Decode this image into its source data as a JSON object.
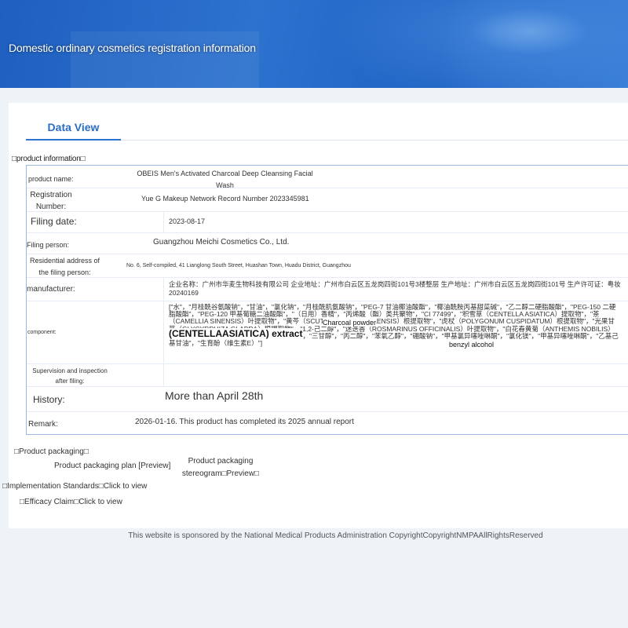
{
  "banner": {
    "title": "Domestic ordinary cosmetics registration information"
  },
  "tabs": {
    "active_label": "Data View"
  },
  "sections": {
    "product_info": "□product information□",
    "product_packaging": "□Product packaging□",
    "implementation_standards": "□Implementation Standards□Click to view",
    "efficacy_claim": "□Efficacy Claim□Click to view"
  },
  "product": {
    "name_label": "product name:",
    "name_value": "OBEIS Men's Activated Charcoal Deep Cleansing Facial Wash",
    "registration_label": "Registration Number:",
    "registration_value": "Yue G Makeup Network Record Number 2023345981",
    "filing_date_label": "Filing date:",
    "filing_date_value": "2023-08-17",
    "filing_person_label": "Filing person:",
    "filing_person_value": "Guangzhou Meichi Cosmetics Co., Ltd.",
    "address_label": "Residential address of the filing person:",
    "address_value": "No. 6, Self-compiled, 41 Lianglong South Street, Huashan Town, Huadu District, Guangzhou",
    "manufacturer_label": "manufacturer:",
    "manufacturer_value": "企业名称：广州市华麦生物科技有限公司 企业地址：广州市白云区五龙岗四街101号3楼整层 生产地址：广州市白云区五龙岗四街101号 生产许可证：粤妆20240169",
    "component_label": "component:",
    "component_value": "[\"水\"，\"月桂酰谷氨酸钠\"，\"甘油\"，\"氯化钠\"，\"月桂酰肌氨酸钠\"，\"PEG-7 甘油椰油酸酯\"，\"椰油酰胺丙基甜菜碱\"，\"乙二醇二硬脂酸酯\"，\"PEG-150 二硬脂酸酯\"，\"PEG-120 甲基葡糖二油酸酯\"，\"（日用）香精\"，\"丙烯酸（酯）类共聚物\"，\"CI 77499\"，\"积雪草（CENTELLA ASIATICA）提取物\"，\"茶（CAMELLIA SINENSIS）叶提取物\"，\"黄芩（SCUTELLARIA BAICALENSIS）根提取物\"，\"虎杖（POLYGONUM CUSPIDATUM）根提取物\"，\"光果甘草（GLYCYRRHIZA GLABRA）根提取物\"，\"1,2-己二醇\"，\"迷迭香（ROSMARINUS OFFICINALIS）叶提取物\"，\"白花春黄菊（ANTHEMIS NOBILIS）花提取物\"，\"聚季铵盐-7\"，\"DMDM 乙内酰脲\"，\"三甘醇\"，\"丙二醇\"，\"苯氧乙醇\"，\"硼酸钠\"，\"甲基氯异噻唑啉酮\"，\"氯化镁\"，\"甲基异噻唑啉酮\"，\"乙基己基甘油\"，\"生育酚（维生素E）\"]",
    "component_overlay_1": "Charcoal powder",
    "component_overlay_2": "(CENTELLAASIATICA) extract",
    "component_overlay_3": "benzyl alcohol",
    "supervision_label": "Supervision and inspection after filing:",
    "supervision_value": "",
    "history_label": "History:",
    "history_value": "More than April 28th",
    "remark_label": "Remark:",
    "remark_value": "2026-01-16. This product has completed its 2025 annual report"
  },
  "packaging": {
    "plan_label": "Product packaging plan [Preview]",
    "stereogram_label": "Product packaging stereogram□Preview□"
  },
  "footer": {
    "text": "This website is sponsored by the National Medical Products Administration CopyrightCopyrightNMPAAllRightsReserved"
  },
  "colors": {
    "banner": "#1f5fbf",
    "accent": "#2a6cc4",
    "table_border": "#9db9dd"
  }
}
